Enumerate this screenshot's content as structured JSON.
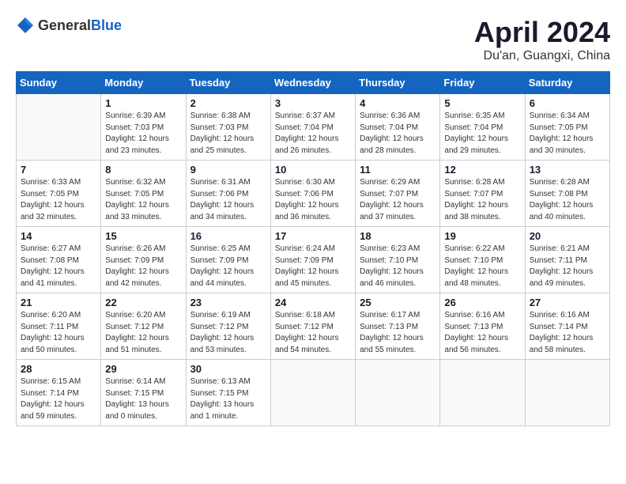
{
  "header": {
    "logo_general": "General",
    "logo_blue": "Blue",
    "month": "April 2024",
    "location": "Du'an, Guangxi, China"
  },
  "weekdays": [
    "Sunday",
    "Monday",
    "Tuesday",
    "Wednesday",
    "Thursday",
    "Friday",
    "Saturday"
  ],
  "weeks": [
    [
      {
        "day": "",
        "sunrise": "",
        "sunset": "",
        "daylight": ""
      },
      {
        "day": "1",
        "sunrise": "Sunrise: 6:39 AM",
        "sunset": "Sunset: 7:03 PM",
        "daylight": "Daylight: 12 hours and 23 minutes."
      },
      {
        "day": "2",
        "sunrise": "Sunrise: 6:38 AM",
        "sunset": "Sunset: 7:03 PM",
        "daylight": "Daylight: 12 hours and 25 minutes."
      },
      {
        "day": "3",
        "sunrise": "Sunrise: 6:37 AM",
        "sunset": "Sunset: 7:04 PM",
        "daylight": "Daylight: 12 hours and 26 minutes."
      },
      {
        "day": "4",
        "sunrise": "Sunrise: 6:36 AM",
        "sunset": "Sunset: 7:04 PM",
        "daylight": "Daylight: 12 hours and 28 minutes."
      },
      {
        "day": "5",
        "sunrise": "Sunrise: 6:35 AM",
        "sunset": "Sunset: 7:04 PM",
        "daylight": "Daylight: 12 hours and 29 minutes."
      },
      {
        "day": "6",
        "sunrise": "Sunrise: 6:34 AM",
        "sunset": "Sunset: 7:05 PM",
        "daylight": "Daylight: 12 hours and 30 minutes."
      }
    ],
    [
      {
        "day": "7",
        "sunrise": "Sunrise: 6:33 AM",
        "sunset": "Sunset: 7:05 PM",
        "daylight": "Daylight: 12 hours and 32 minutes."
      },
      {
        "day": "8",
        "sunrise": "Sunrise: 6:32 AM",
        "sunset": "Sunset: 7:05 PM",
        "daylight": "Daylight: 12 hours and 33 minutes."
      },
      {
        "day": "9",
        "sunrise": "Sunrise: 6:31 AM",
        "sunset": "Sunset: 7:06 PM",
        "daylight": "Daylight: 12 hours and 34 minutes."
      },
      {
        "day": "10",
        "sunrise": "Sunrise: 6:30 AM",
        "sunset": "Sunset: 7:06 PM",
        "daylight": "Daylight: 12 hours and 36 minutes."
      },
      {
        "day": "11",
        "sunrise": "Sunrise: 6:29 AM",
        "sunset": "Sunset: 7:07 PM",
        "daylight": "Daylight: 12 hours and 37 minutes."
      },
      {
        "day": "12",
        "sunrise": "Sunrise: 6:28 AM",
        "sunset": "Sunset: 7:07 PM",
        "daylight": "Daylight: 12 hours and 38 minutes."
      },
      {
        "day": "13",
        "sunrise": "Sunrise: 6:28 AM",
        "sunset": "Sunset: 7:08 PM",
        "daylight": "Daylight: 12 hours and 40 minutes."
      }
    ],
    [
      {
        "day": "14",
        "sunrise": "Sunrise: 6:27 AM",
        "sunset": "Sunset: 7:08 PM",
        "daylight": "Daylight: 12 hours and 41 minutes."
      },
      {
        "day": "15",
        "sunrise": "Sunrise: 6:26 AM",
        "sunset": "Sunset: 7:09 PM",
        "daylight": "Daylight: 12 hours and 42 minutes."
      },
      {
        "day": "16",
        "sunrise": "Sunrise: 6:25 AM",
        "sunset": "Sunset: 7:09 PM",
        "daylight": "Daylight: 12 hours and 44 minutes."
      },
      {
        "day": "17",
        "sunrise": "Sunrise: 6:24 AM",
        "sunset": "Sunset: 7:09 PM",
        "daylight": "Daylight: 12 hours and 45 minutes."
      },
      {
        "day": "18",
        "sunrise": "Sunrise: 6:23 AM",
        "sunset": "Sunset: 7:10 PM",
        "daylight": "Daylight: 12 hours and 46 minutes."
      },
      {
        "day": "19",
        "sunrise": "Sunrise: 6:22 AM",
        "sunset": "Sunset: 7:10 PM",
        "daylight": "Daylight: 12 hours and 48 minutes."
      },
      {
        "day": "20",
        "sunrise": "Sunrise: 6:21 AM",
        "sunset": "Sunset: 7:11 PM",
        "daylight": "Daylight: 12 hours and 49 minutes."
      }
    ],
    [
      {
        "day": "21",
        "sunrise": "Sunrise: 6:20 AM",
        "sunset": "Sunset: 7:11 PM",
        "daylight": "Daylight: 12 hours and 50 minutes."
      },
      {
        "day": "22",
        "sunrise": "Sunrise: 6:20 AM",
        "sunset": "Sunset: 7:12 PM",
        "daylight": "Daylight: 12 hours and 51 minutes."
      },
      {
        "day": "23",
        "sunrise": "Sunrise: 6:19 AM",
        "sunset": "Sunset: 7:12 PM",
        "daylight": "Daylight: 12 hours and 53 minutes."
      },
      {
        "day": "24",
        "sunrise": "Sunrise: 6:18 AM",
        "sunset": "Sunset: 7:12 PM",
        "daylight": "Daylight: 12 hours and 54 minutes."
      },
      {
        "day": "25",
        "sunrise": "Sunrise: 6:17 AM",
        "sunset": "Sunset: 7:13 PM",
        "daylight": "Daylight: 12 hours and 55 minutes."
      },
      {
        "day": "26",
        "sunrise": "Sunrise: 6:16 AM",
        "sunset": "Sunset: 7:13 PM",
        "daylight": "Daylight: 12 hours and 56 minutes."
      },
      {
        "day": "27",
        "sunrise": "Sunrise: 6:16 AM",
        "sunset": "Sunset: 7:14 PM",
        "daylight": "Daylight: 12 hours and 58 minutes."
      }
    ],
    [
      {
        "day": "28",
        "sunrise": "Sunrise: 6:15 AM",
        "sunset": "Sunset: 7:14 PM",
        "daylight": "Daylight: 12 hours and 59 minutes."
      },
      {
        "day": "29",
        "sunrise": "Sunrise: 6:14 AM",
        "sunset": "Sunset: 7:15 PM",
        "daylight": "Daylight: 13 hours and 0 minutes."
      },
      {
        "day": "30",
        "sunrise": "Sunrise: 6:13 AM",
        "sunset": "Sunset: 7:15 PM",
        "daylight": "Daylight: 13 hours and 1 minute."
      },
      {
        "day": "",
        "sunrise": "",
        "sunset": "",
        "daylight": ""
      },
      {
        "day": "",
        "sunrise": "",
        "sunset": "",
        "daylight": ""
      },
      {
        "day": "",
        "sunrise": "",
        "sunset": "",
        "daylight": ""
      },
      {
        "day": "",
        "sunrise": "",
        "sunset": "",
        "daylight": ""
      }
    ]
  ]
}
